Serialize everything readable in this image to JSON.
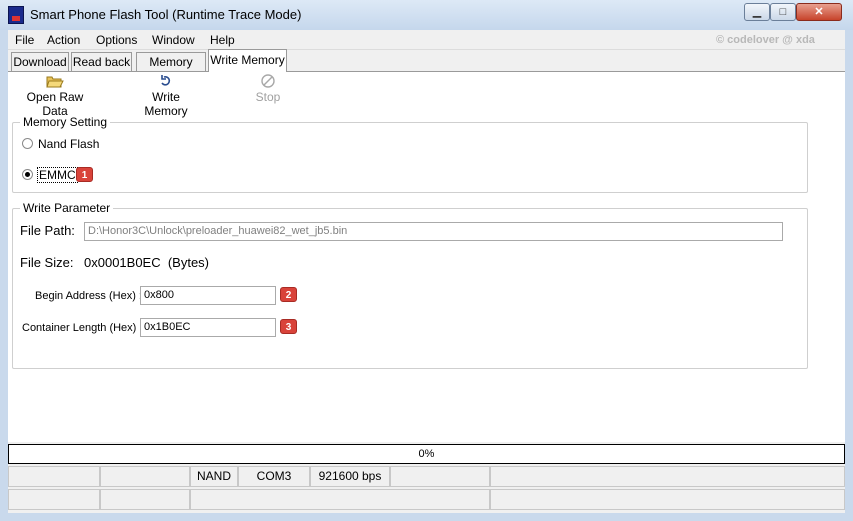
{
  "window": {
    "title": "Smart Phone Flash Tool (Runtime Trace Mode)",
    "controls": {
      "minimize": "▁",
      "maximize": "□",
      "close": "✕"
    }
  },
  "menubar": {
    "items": [
      "File",
      "Action",
      "Options",
      "Window",
      "Help"
    ],
    "watermark": "© codelover @ xda"
  },
  "tabs": [
    {
      "label": "Download"
    },
    {
      "label": "Read back"
    },
    {
      "label": "Memory Test"
    },
    {
      "label": "Write Memory",
      "active": true
    }
  ],
  "toolbar": {
    "open_raw_data": {
      "label": "Open Raw Data",
      "icon": "folder-open-icon"
    },
    "write_memory": {
      "label": "Write Memory",
      "icon": "refresh-arrow-icon"
    },
    "stop": {
      "label": "Stop",
      "icon": "stop-icon",
      "disabled": true
    }
  },
  "memory_setting": {
    "title": "Memory Setting",
    "options": [
      {
        "label": "Nand Flash",
        "checked": false
      },
      {
        "label": "EMMC",
        "checked": true
      }
    ],
    "badge": "1"
  },
  "write_parameter": {
    "title": "Write Parameter",
    "file_path_label": "File Path:",
    "file_path_value": "D:\\Honor3C\\Unlock\\preloader_huawei82_wet_jb5.bin",
    "file_size_label": "File Size:",
    "file_size_value": "0x0001B0EC  (Bytes)",
    "begin_address_label": "Begin Address (Hex) :",
    "begin_address_value": "0x800",
    "begin_address_badge": "2",
    "container_length_label": "Container Length (Hex) :",
    "container_length_value": "0x1B0EC",
    "container_length_badge": "3"
  },
  "progress": {
    "text": "0%",
    "value": 0
  },
  "statusbar": {
    "row1": [
      "",
      "",
      "NAND",
      "COM3",
      "921600 bps",
      "",
      ""
    ],
    "row2": [
      "",
      "",
      "",
      ""
    ]
  },
  "colors": {
    "badge": "#d9433a",
    "titlebar": "#c5d7ec"
  }
}
